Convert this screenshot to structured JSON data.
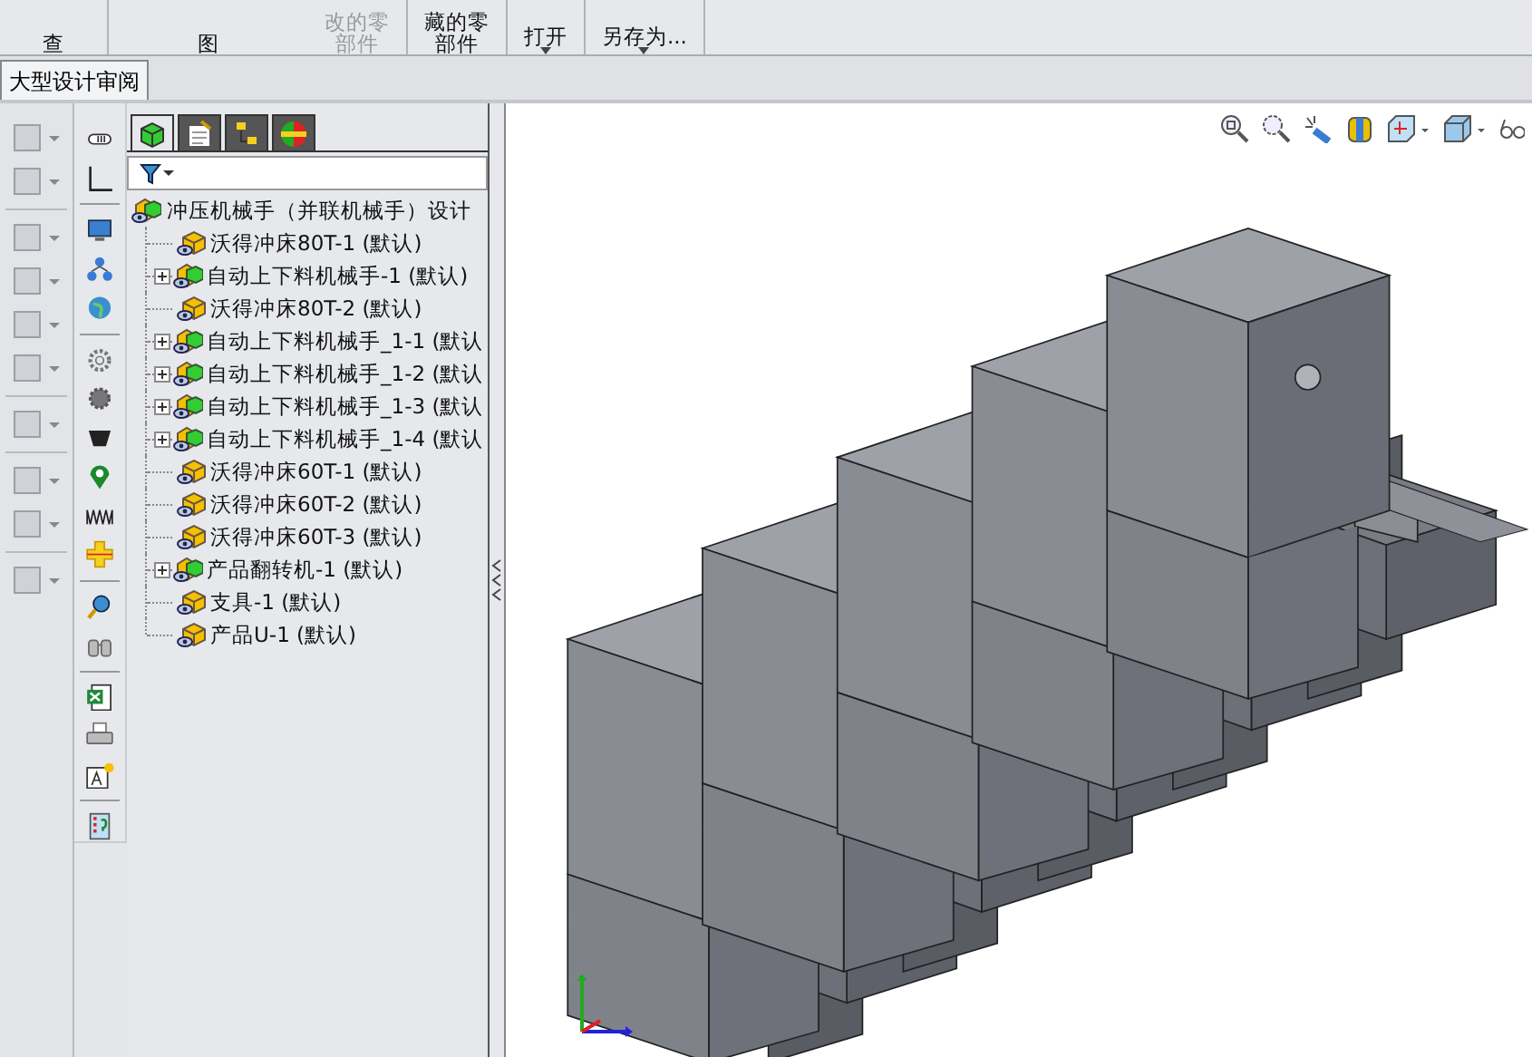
{
  "toolbar": {
    "buttons": [
      {
        "lines": [
          "查"
        ],
        "disabled": false,
        "caret": false
      },
      {
        "lines": [
          "图"
        ],
        "disabled": false,
        "caret": false
      },
      {
        "lines": [
          "改的零",
          "部件"
        ],
        "disabled": true,
        "caret": false
      },
      {
        "lines": [
          "藏的零",
          "部件"
        ],
        "disabled": false,
        "caret": false
      },
      {
        "lines": [
          "打开"
        ],
        "disabled": false,
        "caret": true
      },
      {
        "lines": [
          "另存为..."
        ],
        "disabled": false,
        "caret": true
      }
    ]
  },
  "tabs": [
    {
      "label": "大型设计审阅",
      "selected": true
    }
  ],
  "panel_tabs": [
    {
      "kind": "tree",
      "selected": true
    },
    {
      "kind": "property",
      "selected": false
    },
    {
      "kind": "config",
      "selected": false
    },
    {
      "kind": "appearance",
      "selected": false
    }
  ],
  "tree": {
    "root": "冲压机械手（并联机械手）设计",
    "items": [
      {
        "label": "沃得冲床80T-1 (默认)",
        "kind": "part"
      },
      {
        "label": "自动上下料机械手-1 (默认)",
        "kind": "assembly"
      },
      {
        "label": "沃得冲床80T-2 (默认)",
        "kind": "part"
      },
      {
        "label": "自动上下料机械手_1-1 (默认",
        "kind": "assembly"
      },
      {
        "label": "自动上下料机械手_1-2 (默认",
        "kind": "assembly"
      },
      {
        "label": "自动上下料机械手_1-3 (默认",
        "kind": "assembly"
      },
      {
        "label": "自动上下料机械手_1-4 (默认",
        "kind": "assembly"
      },
      {
        "label": "沃得冲床60T-1 (默认)",
        "kind": "part"
      },
      {
        "label": "沃得冲床60T-2 (默认)",
        "kind": "part"
      },
      {
        "label": "沃得冲床60T-3 (默认)",
        "kind": "part"
      },
      {
        "label": "产品翻转机-1 (默认)",
        "kind": "assembly"
      },
      {
        "label": "支具-1 (默认)",
        "kind": "part"
      },
      {
        "label": "产品U-1 (默认)",
        "kind": "part"
      }
    ]
  }
}
